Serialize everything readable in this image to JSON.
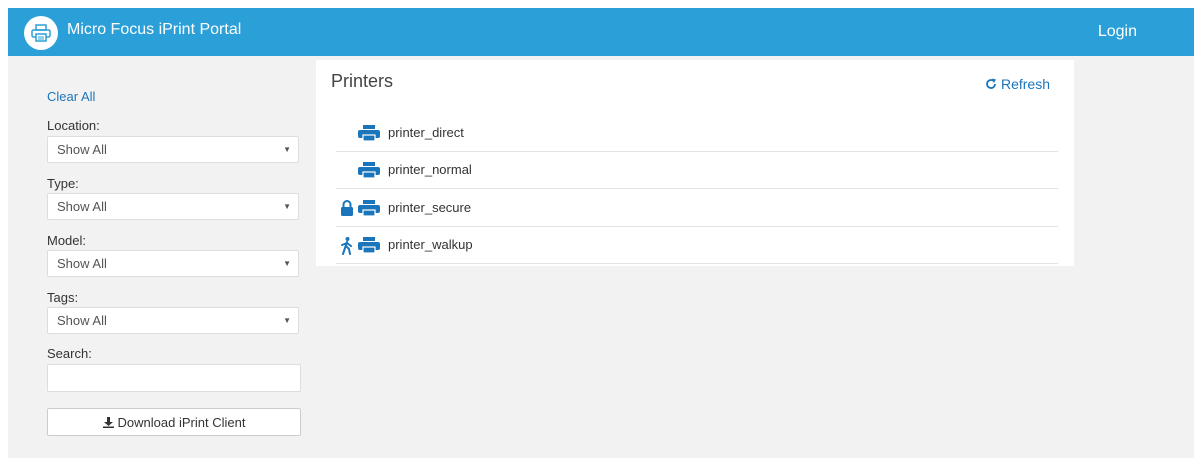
{
  "header": {
    "app_title": "Micro Focus iPrint Portal",
    "login_label": "Login",
    "logo_icon": "printer-icon",
    "bg_color": "#2a9fd8"
  },
  "sidebar": {
    "clear_all": "Clear All",
    "filters": [
      {
        "label": "Location:",
        "value": "Show All"
      },
      {
        "label": "Type:",
        "value": "Show All"
      },
      {
        "label": "Model:",
        "value": "Show All"
      },
      {
        "label": "Tags:",
        "value": "Show All"
      }
    ],
    "search_label": "Search:",
    "search_value": "",
    "download_label": "Download iPrint Client",
    "download_icon": "download-icon"
  },
  "main": {
    "title": "Printers",
    "refresh_label": "Refresh",
    "refresh_icon": "refresh-icon",
    "printers": [
      {
        "name": "printer_direct",
        "badge": null
      },
      {
        "name": "printer_normal",
        "badge": null
      },
      {
        "name": "printer_secure",
        "badge": "lock-icon"
      },
      {
        "name": "printer_walkup",
        "badge": "walking-person-icon"
      }
    ]
  },
  "colors": {
    "accent": "#2a9fd8",
    "link": "#1b75bb",
    "background": "#f2f2f2"
  }
}
